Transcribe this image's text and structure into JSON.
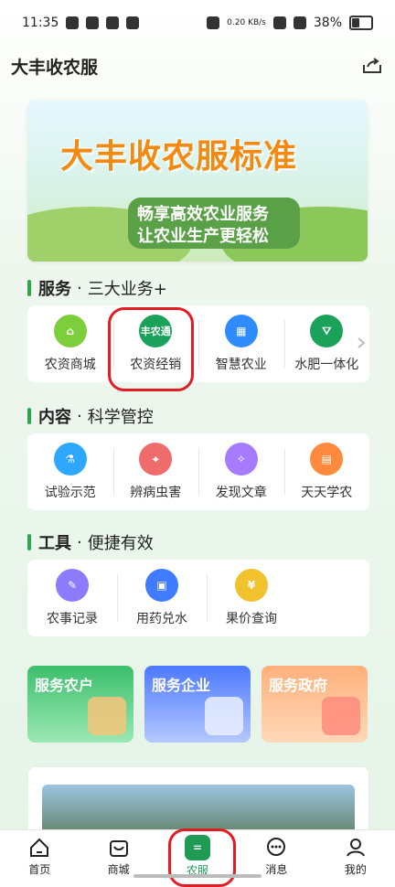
{
  "status": {
    "time": "11:35",
    "net_speed": "0.20 KB/s",
    "battery": "38%"
  },
  "appbar": {
    "title": "大丰收农服",
    "share_icon": "share-icon"
  },
  "banner": {
    "headline": "大丰收农服标准",
    "line1": "畅享高效农业服务",
    "line2": "让农业生产更轻松"
  },
  "sections": {
    "service": {
      "title": "服务",
      "subtitle": "三大业务+",
      "items": [
        {
          "label": "农资商城",
          "icon": "store-icon",
          "color": "#7ccf3a"
        },
        {
          "label": "农资经销",
          "icon": "fengnongtong-logo",
          "badge": "丰农通",
          "color": "#1aa25a"
        },
        {
          "label": "智慧农业",
          "icon": "smart-farm-icon",
          "color": "#2f8cff"
        },
        {
          "label": "水肥一体化",
          "icon": "irrigation-icon",
          "color": "#1aa25a"
        }
      ]
    },
    "content": {
      "title": "内容",
      "subtitle": "科学管控",
      "items": [
        {
          "label": "试验示范",
          "icon": "flask-icon",
          "color": "#2da7ff"
        },
        {
          "label": "辨病虫害",
          "icon": "scan-bug-icon",
          "color": "#f06b6b"
        },
        {
          "label": "发现文章",
          "icon": "discover-icon",
          "color": "#a77bff"
        },
        {
          "label": "天天学农",
          "icon": "book-icon",
          "color": "#ff8a3d"
        }
      ]
    },
    "tools": {
      "title": "工具",
      "subtitle": "便捷有效",
      "items": [
        {
          "label": "农事记录",
          "icon": "notebook-icon",
          "color": "#8a7bff"
        },
        {
          "label": "用药兑水",
          "icon": "dosage-icon",
          "color": "#3f7bff"
        },
        {
          "label": "果价查询",
          "icon": "price-tag-icon",
          "color": "#f2c12e"
        }
      ]
    }
  },
  "cards": [
    {
      "label": "服务农户"
    },
    {
      "label": "服务企业"
    },
    {
      "label": "服务政府"
    }
  ],
  "bottom_nav": [
    {
      "label": "首页",
      "icon": "home-icon"
    },
    {
      "label": "商城",
      "icon": "mall-icon"
    },
    {
      "label": "农服",
      "icon": "agri-service-icon",
      "glyph": "="
    },
    {
      "label": "消息",
      "icon": "message-icon"
    },
    {
      "label": "我的",
      "icon": "profile-icon"
    }
  ],
  "colors": {
    "accent": "#1f9b55",
    "highlight": "#e31b23"
  }
}
